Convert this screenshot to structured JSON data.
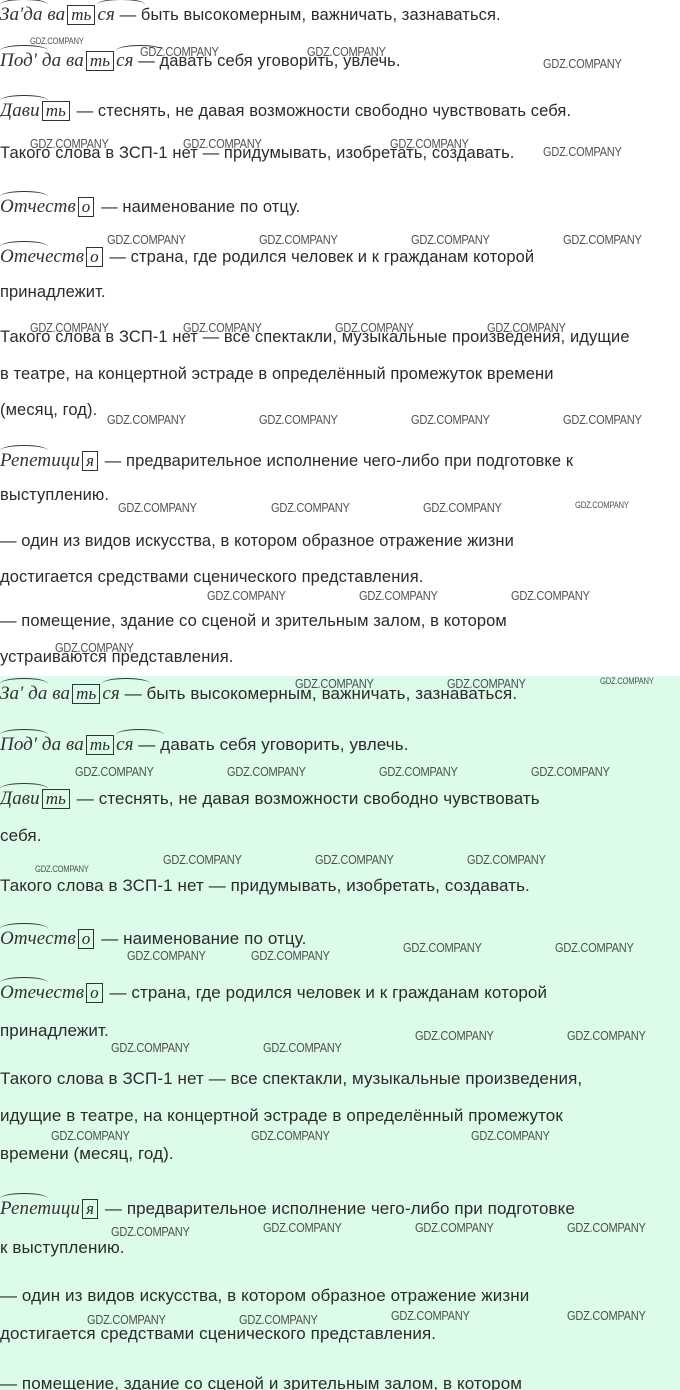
{
  "watermark": "GDZ.COMPANY",
  "top": {
    "entries": [
      {
        "word": "За'да ва",
        "box": "ть",
        "suffix": "ся",
        "text": " — быть высокомерным, важничать, зазнаваться."
      },
      {
        "word": "Под' да ва",
        "box": "ть",
        "suffix": "ся",
        "text": " — давать себя уговорить, увлечь."
      },
      {
        "word": "Дави",
        "box": "ть",
        "suffix": "",
        "text": " — стеснять, не давая возможности свободно чувствовать себя."
      },
      {
        "word": "",
        "box": "",
        "suffix": "",
        "text": "Такого слова в ЗСП-1 нет — придумывать, изобретать, создавать."
      },
      {
        "word": "Отчеств",
        "box": "о",
        "suffix": "",
        "text": " — наименование по отцу."
      },
      {
        "word": "Отечеств",
        "box": "о",
        "suffix": "",
        "text": " — страна, где родился человек и к гражданам которой"
      },
      {
        "word": "",
        "box": "",
        "suffix": "",
        "text": "принадлежит."
      },
      {
        "word": "",
        "box": "",
        "suffix": "",
        "text": "Такого слова в ЗСП-1 нет — все спектакли, музыкальные произведения, идущие"
      },
      {
        "word": "",
        "box": "",
        "suffix": "",
        "text": "в театре, на концертной эстраде в определённый промежуток времени"
      },
      {
        "word": "",
        "box": "",
        "suffix": "",
        "text": "(месяц, год)."
      },
      {
        "word": "Репетици",
        "box": "я",
        "suffix": "",
        "text": " — предварительное исполнение чего-либо при подготовке к"
      },
      {
        "word": "",
        "box": "",
        "suffix": "",
        "text": "выступлению."
      },
      {
        "word": "",
        "box": "",
        "suffix": "",
        "text": "— один из видов искусства, в котором образное отражение жизни"
      },
      {
        "word": "",
        "box": "",
        "suffix": "",
        "text": "достигается средствами сценического представления."
      },
      {
        "word": "",
        "box": "",
        "suffix": "",
        "text": "— помещение, здание со сценой и зрительным залом, в котором"
      },
      {
        "word": "",
        "box": "",
        "suffix": "",
        "text": "устраиваются представления."
      }
    ]
  },
  "bottom": {
    "entries": [
      {
        "word": "За' да ва",
        "box": "ть",
        "suffix": "ся",
        "text": " — быть высокомерным, важничать, зазнаваться."
      },
      {
        "word": "Под' да ва",
        "box": "ть",
        "suffix": "ся",
        "text": " — давать себя уговорить, увлечь."
      },
      {
        "word": "Дави",
        "box": "ть",
        "suffix": "",
        "text": " — стеснять, не давая возможности свободно чувствовать"
      },
      {
        "word": "",
        "box": "",
        "suffix": "",
        "text": "себя."
      },
      {
        "word": "",
        "box": "",
        "suffix": "",
        "text": "Такого слова в ЗСП-1 нет — придумывать, изобретать, создавать."
      },
      {
        "word": "Отчеств",
        "box": "о",
        "suffix": "",
        "text": " — наименование по отцу."
      },
      {
        "word": "Отечеств",
        "box": "о",
        "suffix": "",
        "text": " — страна, где родился человек и к гражданам которой"
      },
      {
        "word": "",
        "box": "",
        "suffix": "",
        "text": "принадлежит."
      },
      {
        "word": "",
        "box": "",
        "suffix": "",
        "text": "Такого слова в ЗСП-1 нет — все спектакли, музыкальные произведения,"
      },
      {
        "word": "",
        "box": "",
        "suffix": "",
        "text": "идущие в театре, на концертной эстраде в определённый промежуток"
      },
      {
        "word": "",
        "box": "",
        "suffix": "",
        "text": "времени (месяц, год)."
      },
      {
        "word": "Репетици",
        "box": "я",
        "suffix": "",
        "text": " — предварительное исполнение чего-либо при подготовке"
      },
      {
        "word": "",
        "box": "",
        "suffix": "",
        "text": "к выступлению."
      },
      {
        "word": "",
        "box": "",
        "suffix": "",
        "text": "— один из видов искусства, в котором образное отражение жизни"
      },
      {
        "word": "",
        "box": "",
        "suffix": "",
        "text": "достигается средствами сценического представления."
      },
      {
        "word": "",
        "box": "",
        "suffix": "",
        "text": "— помещение, здание со сценой и зрительным залом, в котором"
      }
    ]
  },
  "colors": {
    "top_bg": "#ffffff",
    "bottom_bg": "#dcfbe8",
    "text": "#2b2b2b"
  }
}
